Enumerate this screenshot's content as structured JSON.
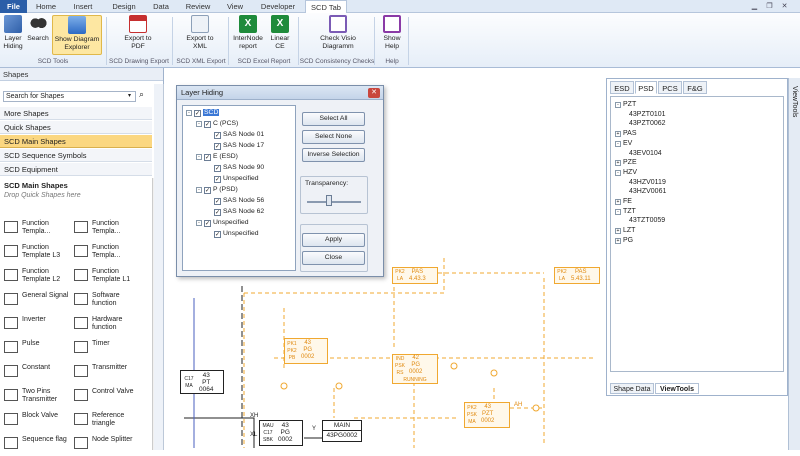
{
  "ribbon_tabs": [
    "File",
    "Home",
    "Insert",
    "Design",
    "Data",
    "Review",
    "View",
    "Developer",
    "SCD Tab"
  ],
  "ribbon_buttons": [
    {
      "label": "Layer Hiding",
      "icon": "layers-icon",
      "color": "#3e6db5"
    },
    {
      "label": "Search",
      "icon": "binoculars-icon",
      "color": "#333333"
    },
    {
      "label": "Show Diagram Explorer",
      "icon": "diagram-explorer-icon",
      "color": "#3b7bd1",
      "selected": true
    },
    {
      "label": "Export to PDF",
      "icon": "pdf-icon",
      "color": "#c62f2f"
    },
    {
      "label": "Export to XML",
      "icon": "xml-icon",
      "color": "#8da0b8"
    },
    {
      "label": "InterNode report",
      "icon": "excel-icon",
      "color": "#1f8b3b"
    },
    {
      "label": "Linear CE",
      "icon": "excel-icon",
      "color": "#1f8b3b"
    },
    {
      "label": "Check Visio Diagramm",
      "icon": "check-visio-icon",
      "color": "#7b5bb5"
    },
    {
      "label": "Show Help",
      "icon": "help-icon",
      "color": "#8a3aa6"
    }
  ],
  "ribbon_groups": [
    "SCD Tools",
    "SCD Drawing Export",
    "SCD XML Export",
    "SCD Excel Report",
    "SCD Consistency Checks",
    "Help"
  ],
  "shapes_pane": {
    "title": "Shapes",
    "search_placeholder": "Search for Shapes",
    "stencils": [
      "More Shapes",
      "Quick Shapes",
      "SCD Main Shapes",
      "SCD Sequence Symbols",
      "SCD Equipment"
    ],
    "selected_stencil": "SCD Main Shapes",
    "section_title": "SCD Main Shapes",
    "drop_hint": "Drop Quick Shapes here",
    "items": [
      "Function Templa...",
      "Function Templa...",
      "Function Template L3",
      "Function Templa...",
      "Function Template L2",
      "Function Template L1",
      "General Signal",
      "Software function",
      "Inverter",
      "Hardware function",
      "Pulse",
      "Timer",
      "Constant",
      "Transmitter",
      "Two Pins Transmitter",
      "Control Valve",
      "Block Valve",
      "Reference triangle",
      "Sequence flag",
      "Node Splitter"
    ]
  },
  "dialog": {
    "title": "Layer Hiding",
    "tree": [
      {
        "label": "SCD",
        "level": 0,
        "checked": true,
        "expander": "-",
        "selected": true
      },
      {
        "label": "C (PCS)",
        "level": 1,
        "checked": true,
        "expander": "-"
      },
      {
        "label": "SAS Node 01",
        "level": 2,
        "checked": true
      },
      {
        "label": "SAS Node 17",
        "level": 2,
        "checked": true
      },
      {
        "label": "E (ESD)",
        "level": 1,
        "checked": true,
        "expander": "-"
      },
      {
        "label": "SAS Node 90",
        "level": 2,
        "checked": true
      },
      {
        "label": "Unspecified",
        "level": 2,
        "checked": true
      },
      {
        "label": "P (PSD)",
        "level": 1,
        "checked": true,
        "expander": "-"
      },
      {
        "label": "SAS Node 56",
        "level": 2,
        "checked": true
      },
      {
        "label": "SAS Node 62",
        "level": 2,
        "checked": true
      },
      {
        "label": "Unspecified",
        "level": 1,
        "checked": true,
        "expander": "-"
      },
      {
        "label": "Unspecified",
        "level": 2,
        "checked": true
      }
    ],
    "buttons": [
      "Select All",
      "Select None",
      "Inverse Selection"
    ],
    "transparency_label": "Transparency:",
    "transparency": 0.4,
    "apply": "Apply",
    "close": "Close"
  },
  "viewtools": {
    "tabs": [
      "ESD",
      "PSD",
      "PCS",
      "F&G"
    ],
    "active_tab": "PSD",
    "tree": [
      {
        "label": "PZT",
        "level": 0,
        "expander": "-"
      },
      {
        "label": "43PZT0101",
        "level": 1
      },
      {
        "label": "43PZT0062",
        "level": 1
      },
      {
        "label": "PAS",
        "level": 0,
        "expander": "+"
      },
      {
        "label": "EV",
        "level": 0,
        "expander": "-"
      },
      {
        "label": "43EV0104",
        "level": 1
      },
      {
        "label": "PZE",
        "level": 0,
        "expander": "+"
      },
      {
        "label": "HZV",
        "level": 0,
        "expander": "-"
      },
      {
        "label": "43HZV0119",
        "level": 1
      },
      {
        "label": "43HZV0061",
        "level": 1
      },
      {
        "label": "FE",
        "level": 0,
        "expander": "+"
      },
      {
        "label": "TZT",
        "level": 0,
        "expander": "-"
      },
      {
        "label": "43TZT0059",
        "level": 1
      },
      {
        "label": "LZT",
        "level": 0,
        "expander": "+"
      },
      {
        "label": "PG",
        "level": 0,
        "expander": "+"
      }
    ],
    "bottom_tabs": [
      "Shape Data",
      "ViewTools"
    ],
    "side_label": "ViewTools"
  },
  "diagram": {
    "blocks_orange": [
      {
        "tag": "PAS",
        "num": "4.43.3",
        "p1": "PK2",
        "p2": "LA"
      },
      {
        "tag": "PAS",
        "num": "5.43.11",
        "p1": "PK2",
        "p2": "LA"
      },
      {
        "tag": "PG",
        "num": "0002",
        "top": "43",
        "p1": "PK1",
        "p2": "PK2",
        "p3": "PB"
      },
      {
        "tag": "PG",
        "num": "0002",
        "top": "42",
        "p1": "IND",
        "p2": "PSK",
        "p3": "RS",
        "sub": "RUNNING"
      },
      {
        "tag": "PZT",
        "num": "0002",
        "top": "43",
        "p1": "PK2",
        "p2": "PSK",
        "p3": "MA"
      }
    ],
    "blocks_black": [
      {
        "tag": "PT",
        "num": "0064",
        "top": "43",
        "p1": "C17",
        "p2": "MA"
      },
      {
        "tag": "PG",
        "num": "0002",
        "top": "43",
        "p1": "MAU",
        "p2": "C17",
        "p3": "SBK"
      },
      {
        "tag": "MAIN",
        "num": "43PG0002"
      }
    ],
    "labels": [
      "XH",
      "XL",
      "Y",
      "AH"
    ]
  }
}
